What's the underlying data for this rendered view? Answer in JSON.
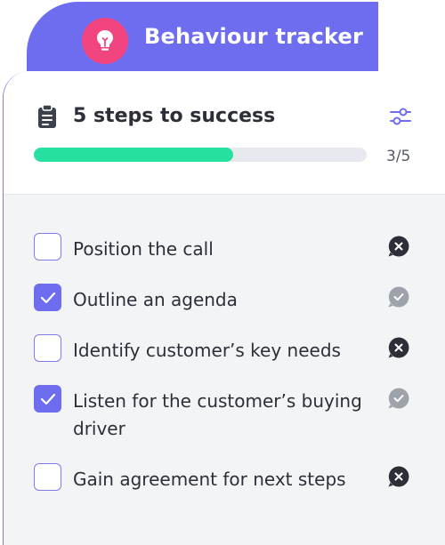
{
  "header": {
    "title": "Behaviour tracker",
    "icon": "lightbulb-icon",
    "colors": {
      "tab": "#6e6df0",
      "badge": "#f2457f"
    }
  },
  "card": {
    "title": "5 steps to success",
    "title_icon": "clipboard-icon",
    "filter_icon": "sliders-icon",
    "progress": {
      "completed": 3,
      "total": 5,
      "text": "3/5",
      "fill_color": "#26e0a0"
    }
  },
  "steps": [
    {
      "label": "Position the call",
      "checked": false,
      "status": "failed"
    },
    {
      "label": "Outline an agenda",
      "checked": true,
      "status": "passed"
    },
    {
      "label": "Identify customer’s key needs",
      "checked": false,
      "status": "failed"
    },
    {
      "label": "Listen for the customer’s buying driver",
      "checked": true,
      "status": "passed"
    },
    {
      "label": "Gain agreement for next steps",
      "checked": false,
      "status": "failed"
    }
  ]
}
